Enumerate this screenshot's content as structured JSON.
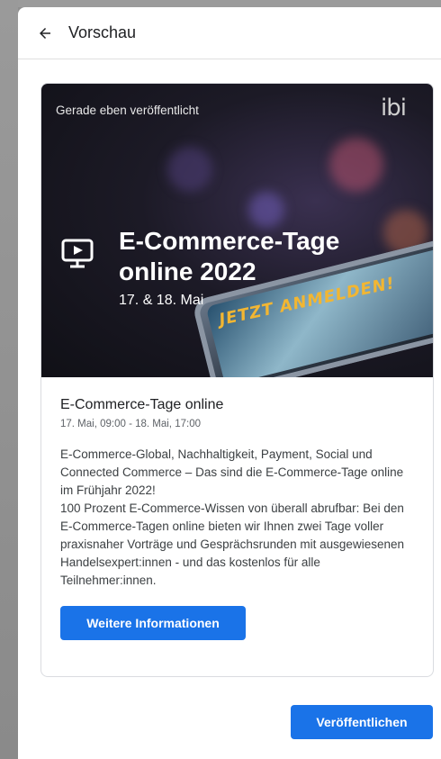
{
  "header": {
    "back_icon": "arrow-left-icon",
    "title": "Vorschau"
  },
  "post": {
    "badge": "Gerade eben veröffentlicht",
    "logo_text": "ibi",
    "banner": {
      "icon": "presentation-screen-icon",
      "title_line1": "E-Commerce-Tage",
      "title_line2": "online 2022",
      "date": "17. & 18. Mai",
      "cta": "JETZT ANMELDEN!"
    },
    "title": "E-Commerce-Tage online",
    "time": "17. Mai, 09:00 - 18. Mai, 17:00",
    "description": "E-Commerce-Global, Nachhaltigkeit, Payment, Social und Connected Commerce – Das sind die E-Commerce-Tage online im Frühjahr 2022!\n100 Prozent E-Commerce-Wissen von überall abrufbar: Bei den E-Commerce-Tagen online bieten wir Ihnen zwei Tage voller praxisnaher Vorträge und Gesprächsrunden mit ausgewiesenen Handelsexpert:innen - und das kostenlos für alle Teilnehmer:innen.",
    "more_button": "Weitere Informationen"
  },
  "footer": {
    "publish_button": "Veröffentlichen"
  },
  "colors": {
    "accent": "#1a73e8",
    "cta": "#f2b632"
  }
}
